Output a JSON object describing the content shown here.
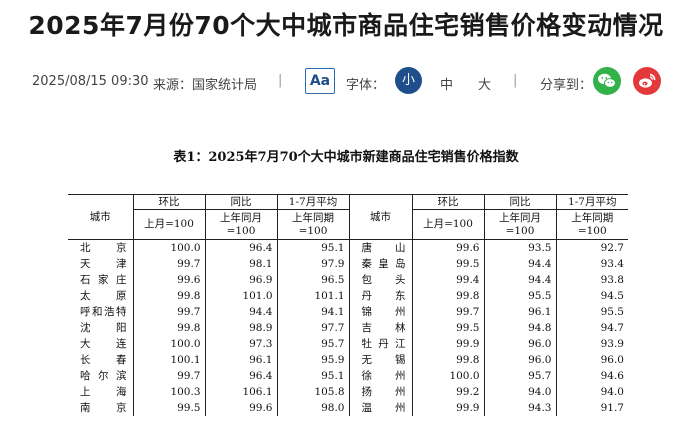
{
  "title": "2025年7月份70个大中城市商品住宅销售价格变动情况",
  "meta": {
    "date": "2025/08/15 09:30",
    "source": "来源：国家统计局",
    "separator": "|",
    "aa_label": "Aa",
    "font_label": "字体：",
    "font_sizes": [
      "小",
      "中",
      "大"
    ],
    "share_label": "分享到：",
    "share_icons": [
      "wechat-icon",
      "weibo-icon"
    ],
    "accent_color": "#1f4e8c"
  },
  "table": {
    "caption": "表1：2025年7月70个大中城市新建商品住宅销售价格指数",
    "header": {
      "city": "城市",
      "mom": "环比",
      "yoy": "同比",
      "ytd": "1-7月平均",
      "mom_base": "上月=100",
      "yoy_base_1": "上年同月",
      "yoy_base_2": "=100",
      "ytd_base_1": "上年同期",
      "ytd_base_2": "=100"
    },
    "rows": [
      {
        "c1": "北京",
        "m1": "100.0",
        "y1": "96.4",
        "a1": "95.1",
        "c2": "唐山",
        "m2": "99.6",
        "y2": "93.5",
        "a2": "92.7"
      },
      {
        "c1": "天津",
        "m1": "99.7",
        "y1": "98.1",
        "a1": "97.9",
        "c2": "秦皇岛",
        "m2": "99.5",
        "y2": "94.4",
        "a2": "93.4"
      },
      {
        "c1": "石家庄",
        "m1": "99.6",
        "y1": "96.9",
        "a1": "96.5",
        "c2": "包头",
        "m2": "99.4",
        "y2": "94.4",
        "a2": "93.8"
      },
      {
        "c1": "太原",
        "m1": "99.8",
        "y1": "101.0",
        "a1": "101.1",
        "c2": "丹东",
        "m2": "99.8",
        "y2": "95.5",
        "a2": "94.5"
      },
      {
        "c1": "呼和浩特",
        "m1": "99.7",
        "y1": "94.4",
        "a1": "94.1",
        "c2": "锦州",
        "m2": "99.7",
        "y2": "96.1",
        "a2": "95.5"
      },
      {
        "c1": "沈阳",
        "m1": "99.8",
        "y1": "98.9",
        "a1": "97.7",
        "c2": "吉林",
        "m2": "99.5",
        "y2": "94.8",
        "a2": "94.7"
      },
      {
        "c1": "大连",
        "m1": "100.0",
        "y1": "97.3",
        "a1": "95.7",
        "c2": "牡丹江",
        "m2": "99.9",
        "y2": "96.0",
        "a2": "93.9"
      },
      {
        "c1": "长春",
        "m1": "100.1",
        "y1": "96.1",
        "a1": "95.9",
        "c2": "无锡",
        "m2": "99.8",
        "y2": "96.0",
        "a2": "96.0"
      },
      {
        "c1": "哈尔滨",
        "m1": "99.7",
        "y1": "96.4",
        "a1": "95.1",
        "c2": "徐州",
        "m2": "100.0",
        "y2": "95.7",
        "a2": "94.6"
      },
      {
        "c1": "上海",
        "m1": "100.3",
        "y1": "106.1",
        "a1": "105.8",
        "c2": "扬州",
        "m2": "99.2",
        "y2": "94.0",
        "a2": "94.0"
      },
      {
        "c1": "南京",
        "m1": "99.5",
        "y1": "99.6",
        "a1": "98.0",
        "c2": "温州",
        "m2": "99.9",
        "y2": "94.3",
        "a2": "91.7"
      }
    ]
  }
}
